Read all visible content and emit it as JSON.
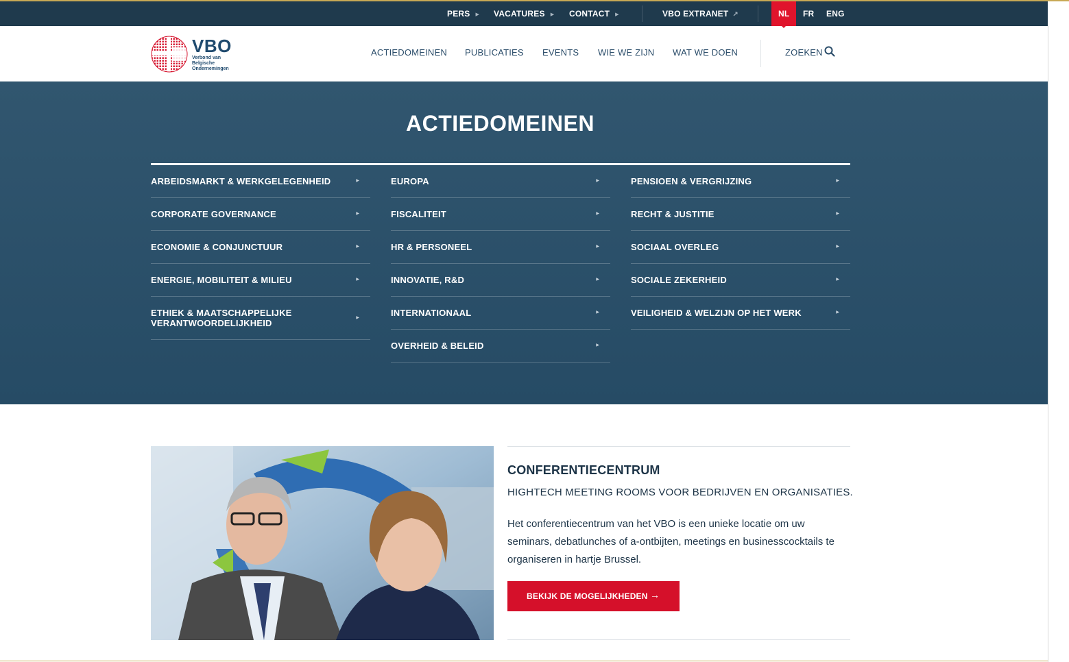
{
  "topbar": {
    "pers": "PERS",
    "vacatures": "VACATURES",
    "contact": "CONTACT",
    "extranet": "VBO EXTRANET",
    "languages": [
      "NL",
      "FR",
      "ENG"
    ],
    "active_language": "NL"
  },
  "logo": {
    "name": "VBO",
    "subtitle": "Verbond van Belgische Ondernemingen"
  },
  "nav": {
    "items": [
      "ACTIEDOMEINEN",
      "PUBLICATIES",
      "EVENTS",
      "WIE WE ZIJN",
      "WAT WE DOEN"
    ],
    "search_label": "ZOEKEN"
  },
  "hero": {
    "title": "ACTIEDOMEINEN",
    "columns": [
      [
        "ARBEIDSMARKT & WERKGELEGENHEID",
        "CORPORATE GOVERNANCE",
        "ECONOMIE & CONJUNCTUUR",
        "ENERGIE, MOBILITEIT & MILIEU",
        "ETHIEK & MAATSCHAPPELIJKE VERANTWOORDELIJKHEID"
      ],
      [
        "EUROPA",
        "FISCALITEIT",
        "HR & PERSONEEL",
        "INNOVATIE, R&D",
        "INTERNATIONAAL",
        "OVERHEID & BELEID"
      ],
      [
        "PENSIOEN & VERGRIJZING",
        "RECHT & JUSTITIE",
        "SOCIAAL OVERLEG",
        "SOCIALE ZEKERHEID",
        "VEILIGHEID & WELZIJN OP HET WERK"
      ]
    ]
  },
  "conference": {
    "title": "CONFERENTIECENTRUM",
    "subtitle": "HIGHTECH MEETING ROOMS VOOR BEDRIJVEN EN ORGANISATIES.",
    "body": "Het conferentiecentrum van het VBO is een unieke locatie om uw seminars, debatlunches of a-ontbijten, meetings en businesscocktails te organiseren in hartje Brussel.",
    "cta_label": "BEKIJK DE MOGELIJKHEDEN"
  },
  "colors": {
    "topbar": "#1f3a4d",
    "hero": "#2a4f68",
    "accent_red": "#d5102a",
    "text_dark": "#1d3447"
  }
}
